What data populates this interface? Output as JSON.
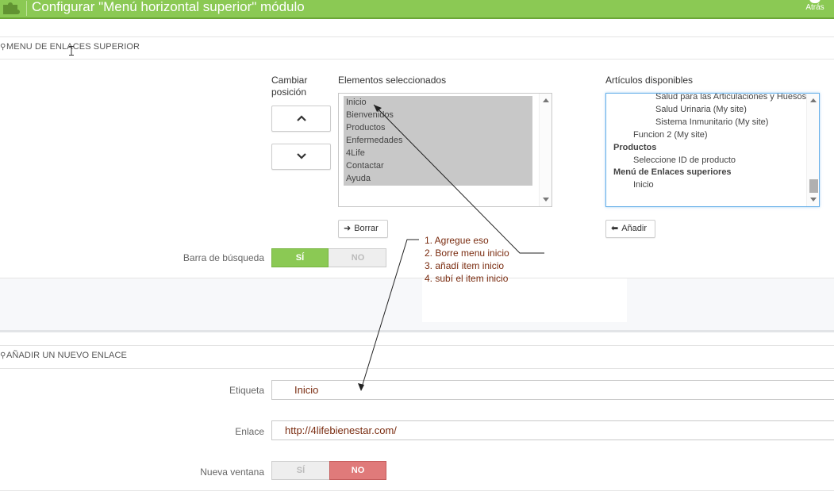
{
  "header": {
    "title": "Configurar \"Menú horizontal superior\" módulo",
    "back_label": "Atrás",
    "bg_color": "#8bc954"
  },
  "section1": {
    "heading": "MENU DE ENLACES SUPERIOR",
    "change_position_label": "Cambiar posición",
    "selected_label": "Elementos seleccionados",
    "available_label": "Artículos disponibles",
    "selected_items": [
      "Inicio",
      "Bienvenidos",
      "Productos",
      "Enfermedades",
      "4Life",
      "Contactar",
      "Ayuda"
    ],
    "available_items": [
      {
        "text": "Salud para las Articulaciones y Huesos",
        "level": 2,
        "bold": false
      },
      {
        "text": "Salud Urinaria (My site)",
        "level": 2,
        "bold": false
      },
      {
        "text": "Sistema Inmunitario (My site)",
        "level": 2,
        "bold": false
      },
      {
        "text": "Funcion 2 (My site)",
        "level": 1,
        "bold": false
      },
      {
        "text": "Productos",
        "level": 0,
        "bold": true
      },
      {
        "text": "Seleccione ID de producto",
        "level": 1,
        "bold": false
      },
      {
        "text": "Menú de Enlaces superiores",
        "level": 0,
        "bold": true
      },
      {
        "text": "Inicio",
        "level": 1,
        "bold": false
      }
    ],
    "delete_button": "Borrar",
    "add_button": "Añadir",
    "search_bar_label": "Barra de búsqueda",
    "search_bar_yes": "SÍ",
    "search_bar_no": "NO"
  },
  "annotation": {
    "lines": [
      "1. Agregue eso",
      "2. Borre menu inicio",
      "3. añadí item inicio",
      "4. subí el item inicio"
    ],
    "color": "#7a2c10"
  },
  "section2": {
    "heading": "AÑADIR UN NUEVO ENLACE",
    "label_label": "Etiqueta",
    "label_value": "Inicio",
    "link_label": "Enlace",
    "link_value": "http://4lifebienestar.com/",
    "new_window_label": "Nueva ventana",
    "new_window_yes": "SÍ",
    "new_window_no": "NO"
  },
  "icons": {
    "header_logo": "puzzle-icon",
    "panel_heading": "link-icon",
    "up": "chevron-up-icon",
    "down": "chevron-down-icon",
    "delete": "arrow-right-icon",
    "add": "arrow-left-icon"
  },
  "colors": {
    "accent_green": "#8bc954",
    "no_red": "#e07a7a",
    "focus_blue": "#66afe9"
  }
}
